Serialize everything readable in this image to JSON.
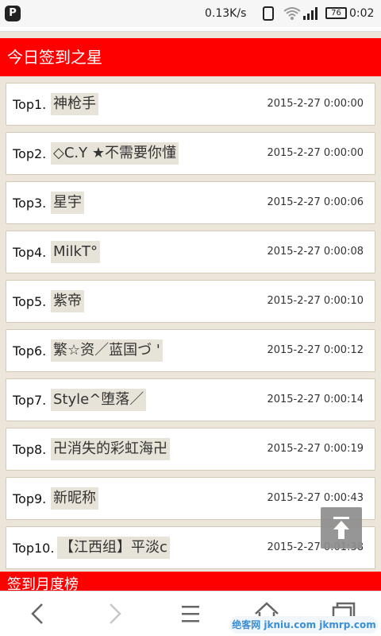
{
  "status_bar": {
    "app_icon": "P",
    "network_speed": "0.13K/s",
    "battery": "76",
    "time": "0:02"
  },
  "section_title": "今日签到之星",
  "rows": [
    {
      "rank": "Top1.",
      "name": "神枪手",
      "time": "2015-2-27 0:00:00"
    },
    {
      "rank": "Top2.",
      "name": "◇C.Y ★不需要你懂",
      "time": "2015-2-27 0:00:00"
    },
    {
      "rank": "Top3.",
      "name": "星宇",
      "time": "2015-2-27 0:00:06"
    },
    {
      "rank": "Top4.",
      "name": "MilkT°",
      "time": "2015-2-27 0:00:08"
    },
    {
      "rank": "Top5.",
      "name": "紫帝",
      "time": "2015-2-27 0:00:10"
    },
    {
      "rank": "Top6.",
      "name": "繁☆资／蓝国づ '",
      "time": "2015-2-27 0:00:12"
    },
    {
      "rank": "Top7.",
      "name": "Style^堕落／",
      "time": "2015-2-27 0:00:14"
    },
    {
      "rank": "Top8.",
      "name": "卍消失的彩虹海卍",
      "time": "2015-2-27 0:00:19"
    },
    {
      "rank": "Top9.",
      "name": "新昵称",
      "time": "2015-2-27 0:00:43"
    },
    {
      "rank": "Top10.",
      "name": "【江西组】平淡c",
      "time": "2015-2-27 0:01:38"
    }
  ],
  "next_section_title": "签到月度榜",
  "watermark": "绝客网 jkniu.com jkmrp.com",
  "colors": {
    "header_red": "#ff0000",
    "page_bg": "#ece6da",
    "name_bg": "#e8e3d8"
  }
}
